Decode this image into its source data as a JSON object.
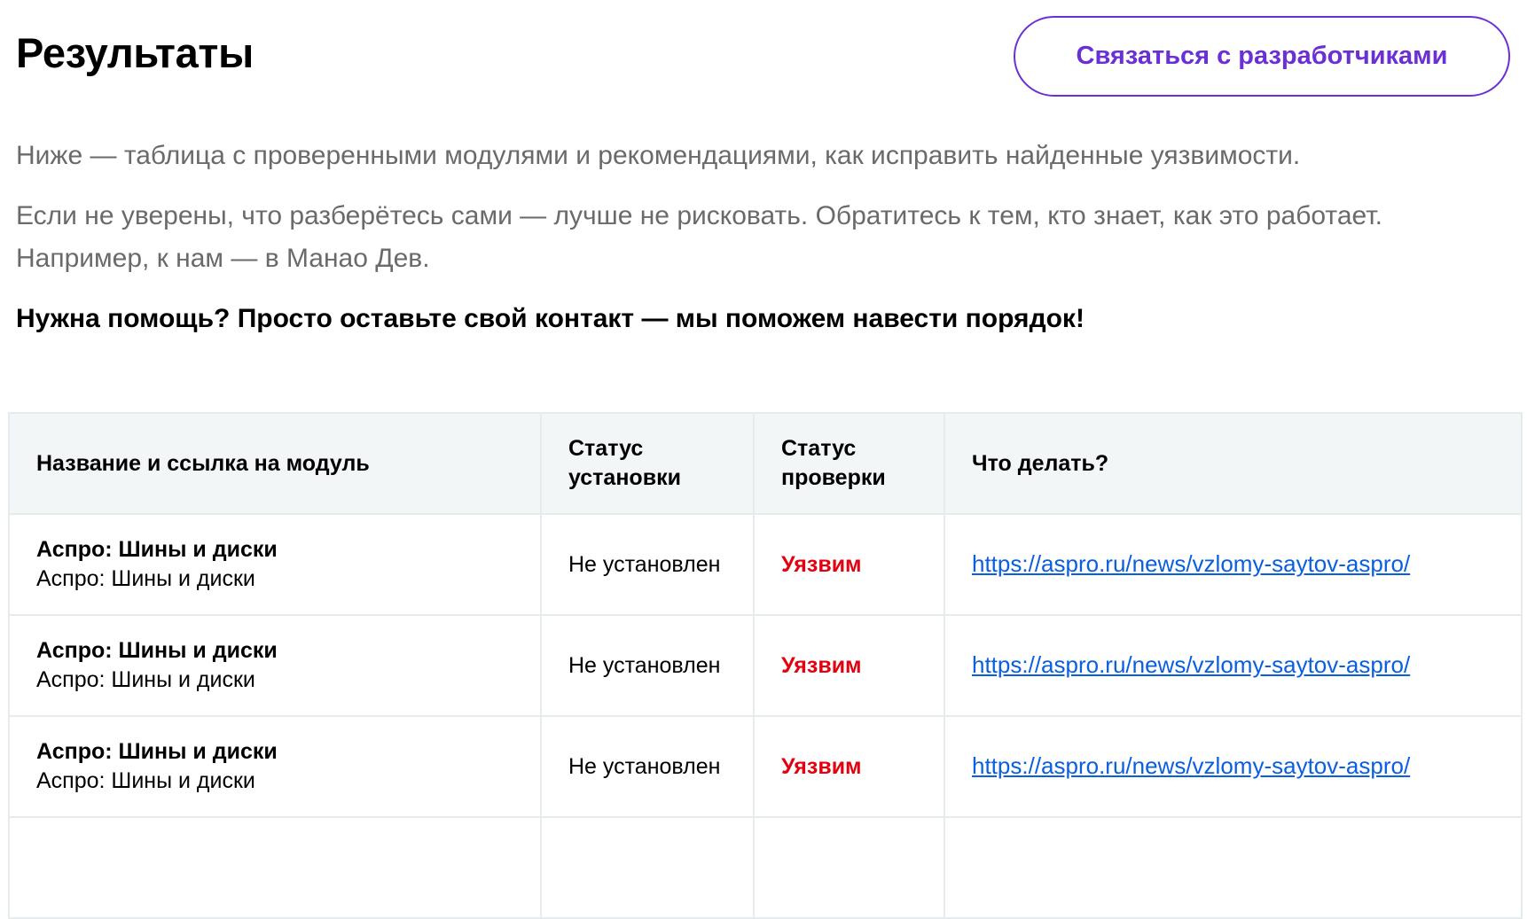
{
  "header": {
    "title": "Результаты",
    "contact_button": "Связаться с разработчиками"
  },
  "intro": {
    "paragraph1": "Ниже — таблица с проверенными модулями и рекомендациями, как исправить найденные уязвимости.",
    "paragraph2": "Если не уверены, что разберётесь сами — лучше не рисковать. Обратитесь к тем, кто знает, как это работает. Например, к нам — в Манао Дев.",
    "cta": "Нужна помощь? Просто оставьте свой контакт — мы поможем навести порядок!"
  },
  "table": {
    "columns": [
      "Название и ссылка на модуль",
      "Статус установки",
      "Статус проверки",
      "Что делать?"
    ],
    "rows": [
      {
        "name": "Аспро: Шины и диски",
        "subname": "Аспро: Шины и диски",
        "install_status": "Не установлен",
        "check_status": "Уязвим",
        "action_link": "https://aspro.ru/news/vzlomy-saytov-aspro/"
      },
      {
        "name": "Аспро: Шины и диски",
        "subname": "Аспро: Шины и диски",
        "install_status": "Не установлен",
        "check_status": "Уязвим",
        "action_link": "https://aspro.ru/news/vzlomy-saytov-aspro/"
      },
      {
        "name": "Аспро: Шины и диски",
        "subname": "Аспро: Шины и диски",
        "install_status": "Не установлен",
        "check_status": "Уязвим",
        "action_link": "https://aspro.ru/news/vzlomy-saytov-aspro/"
      }
    ]
  },
  "colors": {
    "accent": "#6b2fd6",
    "vulnerable": "#e3000f",
    "link": "#0a5fe0",
    "header_bg": "#f2f6f7"
  }
}
